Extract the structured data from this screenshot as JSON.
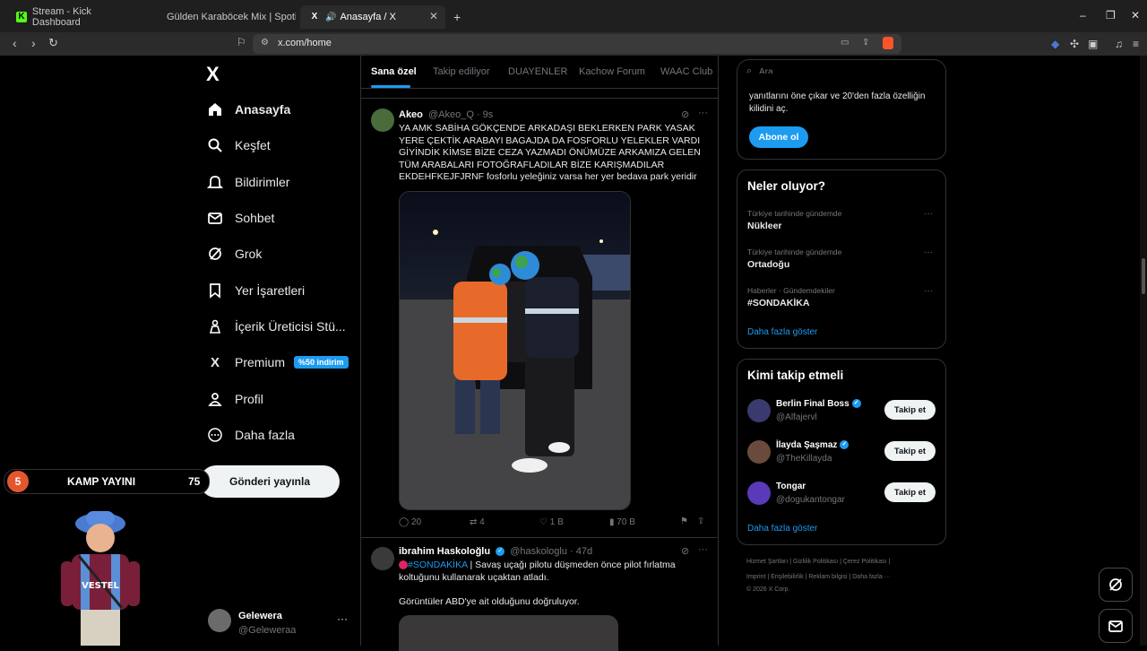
{
  "browser": {
    "tabs": [
      {
        "title": "Stream - Kick Dashboard"
      },
      {
        "title": "Gülden Karaböcek Mix | Spotify Playli"
      },
      {
        "title": "Anasayfa / X"
      }
    ],
    "new_tab": "+",
    "url": "x.com/home",
    "window_controls": [
      "–",
      "❐",
      "✕"
    ]
  },
  "sidebar": {
    "logo": "X",
    "items": [
      {
        "label": "Anasayfa",
        "icon": "home-icon",
        "glyph": "⌂"
      },
      {
        "label": "Keşfet",
        "icon": "search-icon",
        "glyph": "⌕"
      },
      {
        "label": "Bildirimler",
        "icon": "bell-icon",
        "glyph": "♫"
      },
      {
        "label": "Sohbet",
        "icon": "mail-icon",
        "glyph": "✉"
      },
      {
        "label": "Grok",
        "icon": "grok-icon",
        "glyph": "⊘"
      },
      {
        "label": "Yer İşaretleri",
        "icon": "bookmark-icon",
        "glyph": "⚑"
      },
      {
        "label": "İçerik Üreticisi Stü...",
        "icon": "creator-icon",
        "glyph": "♙"
      },
      {
        "label": "Premium",
        "icon": "x-premium-icon",
        "glyph": "X"
      },
      {
        "label": "Profil",
        "icon": "profile-icon",
        "glyph": "♙"
      },
      {
        "label": "Daha fazla",
        "icon": "more-icon",
        "glyph": "⋯"
      }
    ],
    "premium_badge": "%50 indirim",
    "post_button": "Gönderi yayınla",
    "account": {
      "name": "Gelewera",
      "handle": "@Geleweraa",
      "more": "···"
    }
  },
  "overlay": {
    "kamp_number": "5",
    "kamp_title": "KAMP YAYINI",
    "kamp_count": "75",
    "mascot_text": "VESTEL"
  },
  "feed": {
    "tabs": [
      "Sana özel",
      "Takip ediliyor",
      "DUAYENLER",
      "Kachow Forum",
      "WAAC Club"
    ],
    "tweets": [
      {
        "name": "Akeo",
        "handle": "@Akeo_Q · 9s",
        "text": "YA AMK SABİHA GÖKÇENDE ARKADAŞI BEKLERKEN PARK YASAK YERE ÇEKTİK ARABAYI BAGAJDA DA FOSFORLU YELEKLER VARDI GİYİNDİK KİMSE BİZE CEZA YAZMADI ÖNÜMÜZE ARKAMIZA GELEN TÜM ARABALARI FOTOĞRAFLADILAR BİZE KARIŞMADILAR EKDEHFKEJFJRNF fosforlu yeleğiniz varsa her yer bedava park yeridir",
        "replies": "20",
        "retweets": "4",
        "likes": "1 B",
        "views": "70 B"
      },
      {
        "name": "ibrahim Haskoloğlu",
        "handle": "@haskologlu · 47d",
        "hashtag": "#SONDAKİKA",
        "text": "| Savaş uçağı pilotu düşmeden önce pilot fırlatma koltuğunu kullanarak uçaktan atladı.",
        "text2": "Görüntüler ABD'ye ait olduğunu doğruluyor."
      }
    ]
  },
  "right": {
    "search_placeholder": "Ara",
    "premium_card": {
      "text": "yanıtlarını öne çıkar ve 20'den fazla özelliğin kilidini aç.",
      "button": "Abone ol"
    },
    "trends": {
      "title": "Neler oluyor?",
      "items": [
        {
          "category": "Türkiye tarihinde gündemde",
          "topic": "Nükleer"
        },
        {
          "category": "Türkiye tarihinde gündemde",
          "topic": "Ortadoğu"
        },
        {
          "category": "Haberler · Gündemdekiler",
          "topic": "#SONDAKİKA"
        }
      ],
      "more": "Daha fazla göster"
    },
    "who_to_follow": {
      "title": "Kimi takip etmeli",
      "items": [
        {
          "name": "Berlin Final Boss",
          "handle": "@Alfajervl",
          "button": "Takip et",
          "color": "#3b3a6e"
        },
        {
          "name": "İlayda Şaşmaz",
          "handle": "@TheKillayda",
          "button": "Takip et",
          "color": "#6a4a3a"
        },
        {
          "name": "Tongar",
          "handle": "@dogukantongar",
          "button": "Takip et",
          "color": "#5a3ab8"
        }
      ],
      "more": "Daha fazla göster"
    },
    "footer": {
      "row1": "Hizmet Şartları  |  Gizlilik Politikası  |  Çerez Politikası  |",
      "row2": "Imprint  |  Erişilebilirlik  |  Reklam bilgisi  |  Daha fazla ···",
      "row3": "© 2026 X Corp."
    }
  },
  "colors": {
    "accent": "#1d9bf0",
    "background": "#000000",
    "border": "#2f3336",
    "muted": "#71767b"
  }
}
